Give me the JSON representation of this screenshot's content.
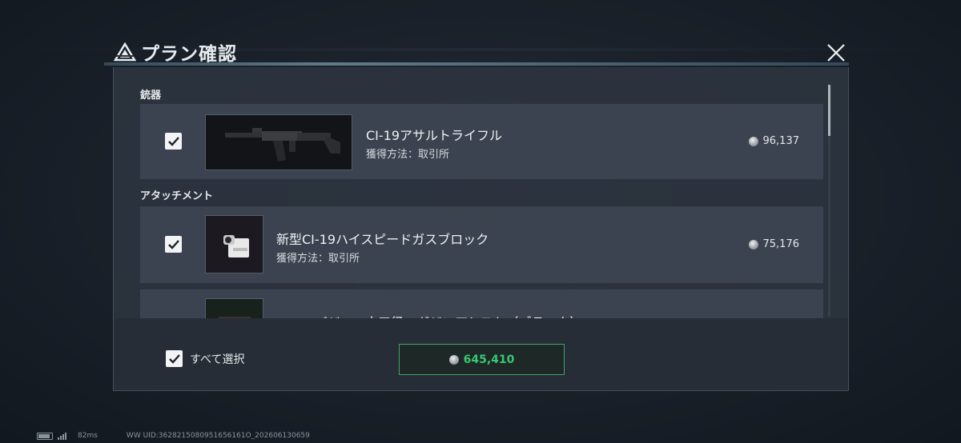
{
  "header": {
    "title": "プラン確認",
    "close_icon": "close-icon"
  },
  "sections": [
    {
      "title": "銃器",
      "items": [
        {
          "name": "CI-19アサルトライフル",
          "method": "獲得方法：取引所",
          "price": "96,137",
          "checked": true,
          "thumb_icon": "assault-rifle-icon"
        }
      ]
    },
    {
      "title": "アタッチメント",
      "items": [
        {
          "name": "新型CI-19ハイスピードガスブロック",
          "method": "獲得方法：取引所",
          "price": "75,176",
          "checked": true,
          "thumb_icon": "gas-block-icon"
        },
        {
          "name": "ハニーバジャー小口径マガジンアシスト（ブラック）",
          "method": "",
          "price": "",
          "checked": true,
          "thumb_icon": "magazine-icon"
        }
      ]
    }
  ],
  "footer": {
    "select_all_label": "すべて選択",
    "select_all_checked": true,
    "total": "645,410",
    "total_color": "#37c873"
  },
  "status_bar": {
    "ping": "82ms",
    "uid": "WW UID:3628215080951656161O_202606130659"
  },
  "colors": {
    "panel": "#2c343e",
    "accent_green": "#3ea56a"
  }
}
